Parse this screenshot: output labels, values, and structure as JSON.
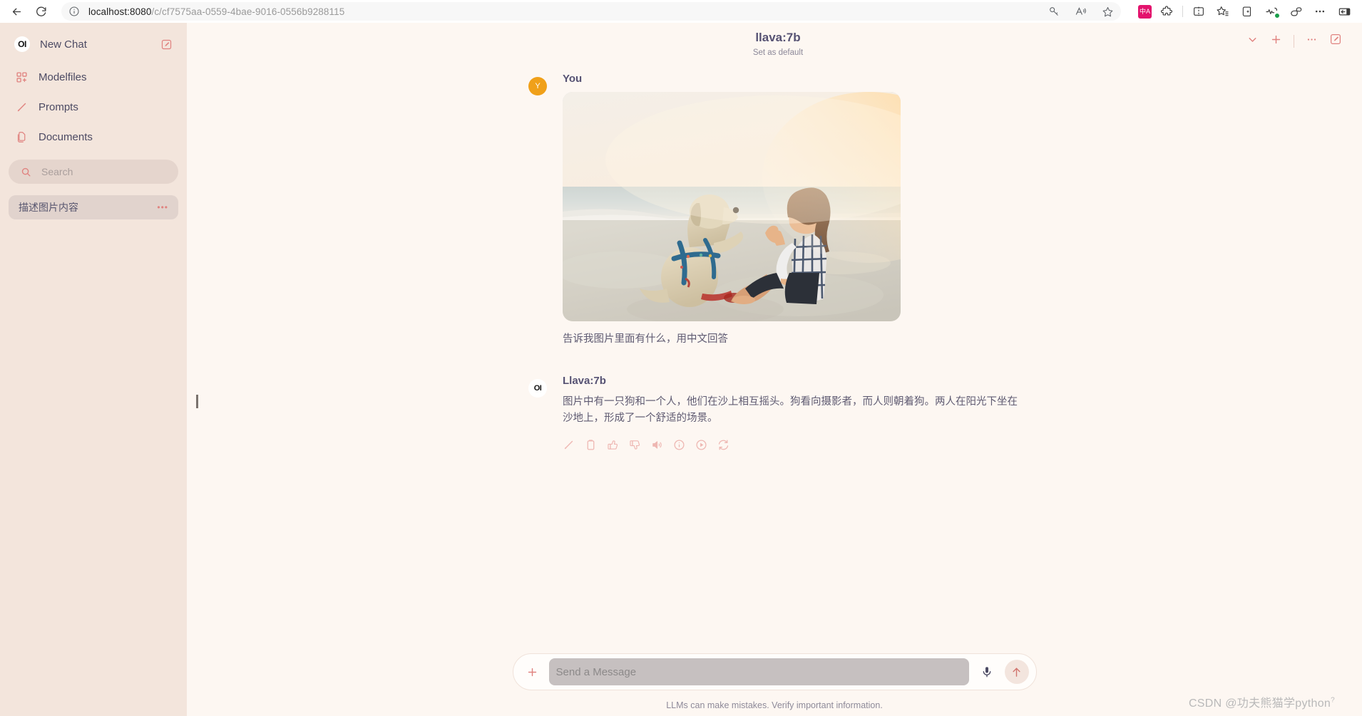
{
  "browser": {
    "back_label": "Back",
    "reload_label": "Refresh",
    "url_host": "localhost:8080",
    "url_path": "/c/cf7575aa-0559-4bae-9016-0556b9288115",
    "icons": {
      "info": "info-icon",
      "key": "key-icon",
      "read_aloud": "read-aloud-icon",
      "favorite": "favorite-star-icon",
      "translate": "translate-icon",
      "extensions": "extensions-icon",
      "split_screen": "split-screen-icon",
      "favorites_list": "favorites-list-icon",
      "collections": "collections-icon",
      "browser_essentials": "browser-essentials-icon",
      "copilot": "copilot-icon",
      "settings_more": "more-settings-icon",
      "sidebar": "sidebar-toggle-icon"
    },
    "translate_badge": "中A"
  },
  "sidebar": {
    "logo": "OI",
    "new_chat_label": "New Chat",
    "items": [
      {
        "label": "Modelfiles",
        "icon": "modelfiles-icon"
      },
      {
        "label": "Prompts",
        "icon": "pencil-icon"
      },
      {
        "label": "Documents",
        "icon": "documents-icon"
      }
    ],
    "search_placeholder": "Search",
    "chats": [
      {
        "title": "描述图片内容",
        "menu": "•••"
      }
    ]
  },
  "header": {
    "model": "llava:7b",
    "set_as_default": "Set as default",
    "actions": [
      "chevron-down-icon",
      "plus-icon",
      "more-icon",
      "new-chat-edit-icon"
    ]
  },
  "conversation": {
    "user": {
      "avatar_initial": "Y",
      "name": "You",
      "image_alt": "Woman sitting on beach high-fiving a labrador dog at sunset",
      "text": "告诉我图片里面有什么，用中文回答"
    },
    "assistant": {
      "avatar_initial": "OI",
      "name": "Llava:7b",
      "text": "图片中有一只狗和一个人，他们在沙上相互摇头。狗看向摄影者，而人则朝着狗。两人在阳光下坐在沙地上，形成了一个舒适的场景。",
      "actions": [
        "edit-icon",
        "copy-icon",
        "thumbs-up-icon",
        "thumbs-down-icon",
        "speaker-icon",
        "info-icon",
        "play-circle-icon",
        "regenerate-icon"
      ]
    }
  },
  "composer": {
    "add_label": "+",
    "placeholder": "Send a Message",
    "mic_icon": "microphone-icon",
    "send_icon": "send-arrow-icon"
  },
  "footer": {
    "disclaimer": "LLMs can make mistakes. Verify important information.",
    "watermark": "CSDN @功夫熊猫学python"
  },
  "colors": {
    "sidebar_bg": "#f3e5dc",
    "main_bg": "#fdf7f2",
    "accent": "#e0827f",
    "text": "#565273",
    "user_avatar": "#f0a019",
    "translate": "#e3136d"
  }
}
